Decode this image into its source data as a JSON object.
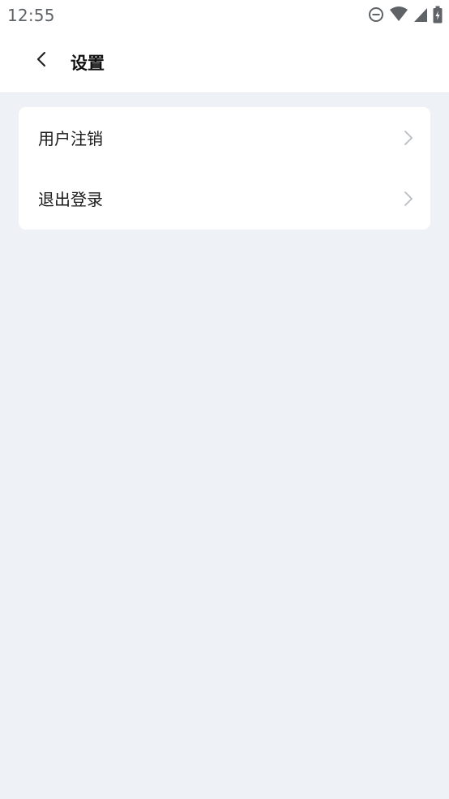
{
  "status_bar": {
    "time": "12:55",
    "icons": [
      "dnd-icon",
      "wifi-icon",
      "signal-icon",
      "battery-icon"
    ]
  },
  "nav": {
    "back_icon": "chevron-left-icon",
    "title": "设置"
  },
  "menu": {
    "items": [
      {
        "label": "用户注销",
        "icon": "chevron-right-icon"
      },
      {
        "label": "退出登录",
        "icon": "chevron-right-icon"
      }
    ]
  },
  "colors": {
    "background": "#eef1f5",
    "surface": "#ffffff",
    "text_primary": "#111111",
    "chevron": "#b8bcc2"
  }
}
